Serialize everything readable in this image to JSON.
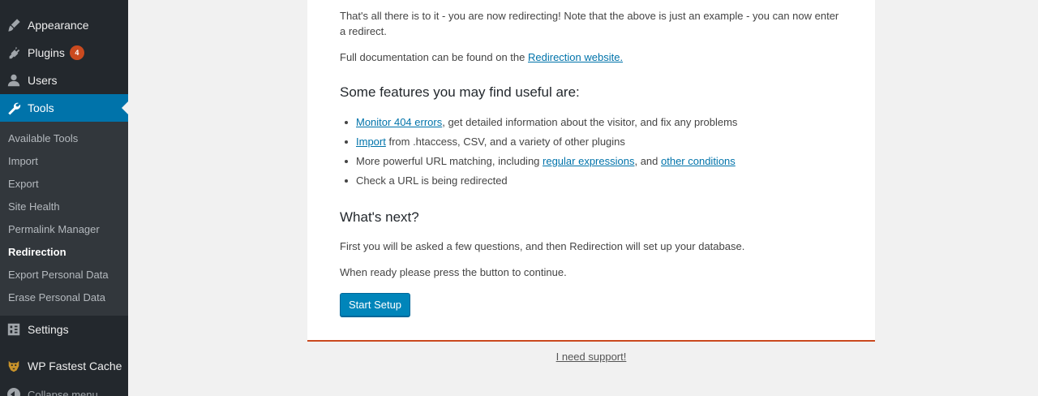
{
  "sidebar": {
    "appearance": {
      "label": "Appearance",
      "icon": "paintbrush-icon"
    },
    "plugins": {
      "label": "Plugins",
      "badge": "4",
      "icon": "plugin-icon"
    },
    "users": {
      "label": "Users",
      "icon": "user-icon"
    },
    "tools": {
      "label": "Tools",
      "icon": "wrench-icon"
    },
    "submenu": [
      {
        "label": "Available Tools"
      },
      {
        "label": "Import"
      },
      {
        "label": "Export"
      },
      {
        "label": "Site Health"
      },
      {
        "label": "Permalink Manager"
      },
      {
        "label": "Redirection",
        "current": true
      },
      {
        "label": "Export Personal Data"
      },
      {
        "label": "Erase Personal Data"
      }
    ],
    "settings": {
      "label": "Settings",
      "icon": "settings-icon"
    },
    "fastest_cache": {
      "label": "WP Fastest Cache",
      "icon": "cheetah-icon"
    },
    "collapse": {
      "label": "Collapse menu"
    }
  },
  "main": {
    "intro_text": "That's all there is to it - you are now redirecting! Note that the above is just an example - you can now enter a redirect.",
    "docs_prefix": "Full documentation can be found on the ",
    "docs_link": "Redirection website.",
    "features_heading": "Some features you may find useful are:",
    "features": {
      "f1_link": "Monitor 404 errors",
      "f1_text": ", get detailed information about the visitor, and fix any problems",
      "f2_link": "Import",
      "f2_text": " from .htaccess, CSV, and a variety of other plugins",
      "f3_text": "More powerful URL matching, including ",
      "f3_link1": "regular expressions",
      "f3_mid": ", and ",
      "f3_link2": "other conditions",
      "f4_text": "Check a URL is being redirected"
    },
    "next_heading": "What's next?",
    "next_text1": "First you will be asked a few questions, and then Redirection will set up your database.",
    "next_text2": "When ready please press the button to continue.",
    "start_button": "Start Setup",
    "support_link": "I need support!"
  },
  "colors": {
    "sidebar_bg": "#23282d",
    "submenu_bg": "#32373c",
    "accent": "#0073aa",
    "badge": "#ca4a1f",
    "button": "#0085ba"
  }
}
